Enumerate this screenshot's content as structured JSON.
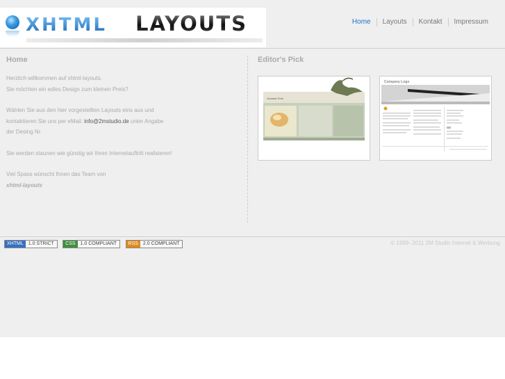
{
  "logo": {
    "left_word": "XHTML",
    "right_word": "LAYOUTS"
  },
  "nav": {
    "items": [
      "Home",
      "Layouts",
      "Kontakt",
      "Impressum"
    ]
  },
  "main": {
    "title": "Home",
    "p1": [
      "Herzlich willkommen auf xhtml-layouts.",
      "Sie möchten ein edles Design zum kleinen Preis?"
    ],
    "p2_line1": "Wählen Sie aus den hier vorgestellten Layouts eins aus und",
    "p2_line2_pre": "kontaktieren Sie uns per eMail: ",
    "p2_email": "info@2mstudio.de",
    "p2_line2_post": " unter Angabe",
    "p2_line3": "der Desing Nr.",
    "p3": "Sie werden staunen wie günstig wir Ihren Internetauftritt realisieren!",
    "p4": "Viel Spass wünscht Ihnen das Team von",
    "signature": "xhtml-layouts"
  },
  "editors_pick": {
    "title": "Editor's Pick",
    "thumb1_title": "Jurassic Free",
    "thumb2_title": "Company Logo"
  },
  "footer": {
    "badges": [
      {
        "key": "XHTML",
        "value": "1.0 STRICT"
      },
      {
        "key": "CSS",
        "value": "1.0 COMPLIANT"
      },
      {
        "key": "RSS",
        "value": "2.0 COMPLIANT"
      }
    ],
    "copyright": "© 1999- 2011 2M Studio Internet & Werbung"
  }
}
